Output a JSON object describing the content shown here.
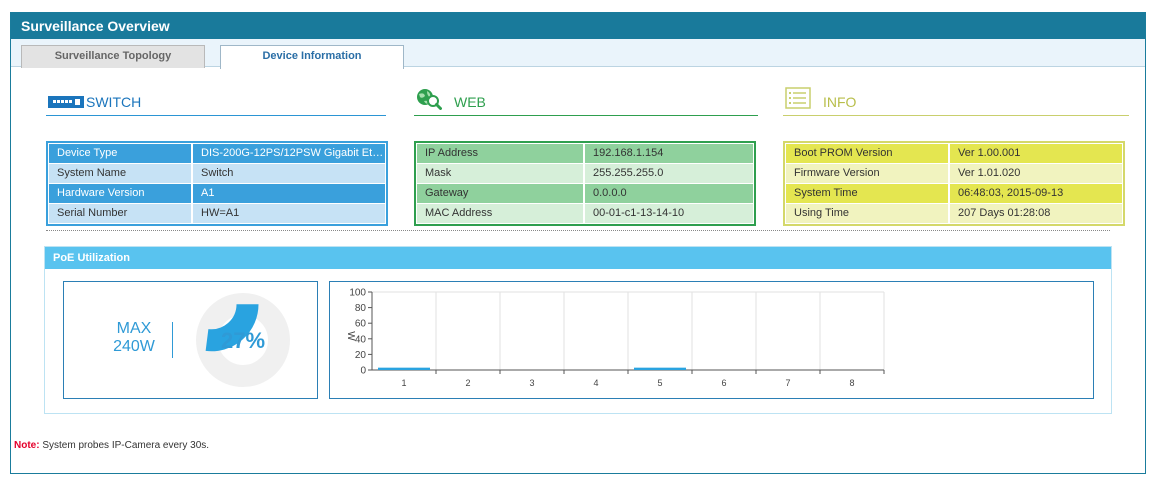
{
  "window": {
    "title": "Surveillance Overview"
  },
  "tabs": [
    {
      "label": "Surveillance Topology",
      "active": false
    },
    {
      "label": "Device Information",
      "active": true
    }
  ],
  "switch_panel": {
    "title": "SWITCH",
    "icon": "switch-icon",
    "rows": [
      {
        "key": "Device Type",
        "value": "DIS-200G-12PS/12PSW Gigabit Ethe..."
      },
      {
        "key": "System Name",
        "value": "Switch"
      },
      {
        "key": "Hardware Version",
        "value": "A1"
      },
      {
        "key": "Serial Number",
        "value": "HW=A1"
      }
    ],
    "colors": {
      "accent": "#3aa0dc",
      "light": "#c6e2f5"
    }
  },
  "web_panel": {
    "title": "WEB",
    "icon": "globe-search-icon",
    "rows": [
      {
        "key": "IP Address",
        "value": "192.168.1.154"
      },
      {
        "key": "Mask",
        "value": "255.255.255.0"
      },
      {
        "key": "Gateway",
        "value": "0.0.0.0"
      },
      {
        "key": "MAC Address",
        "value": "00-01-c1-13-14-10"
      }
    ],
    "colors": {
      "accent": "#8fd19d",
      "light": "#d6efd9"
    }
  },
  "info_panel": {
    "title": "INFO",
    "icon": "list-icon",
    "rows": [
      {
        "key": "Boot PROM Version",
        "value": "Ver 1.00.001"
      },
      {
        "key": "Firmware Version",
        "value": "Ver 1.01.020"
      },
      {
        "key": "System Time",
        "value": "06:48:03, 2015-09-13"
      },
      {
        "key": "Using Time",
        "value": "207 Days 01:28:08"
      }
    ],
    "colors": {
      "accent": "#e4e650",
      "light": "#f1f3bf"
    }
  },
  "poe": {
    "title": "PoE Utilization",
    "max_line1": "MAX",
    "max_line2": "240W",
    "utilization_percent": 27,
    "utilization_label": "27%",
    "colors": {
      "header": "#59c3ef",
      "gauge": "#29a3e0",
      "gauge_track": "#f0f0f0"
    }
  },
  "chart_data": {
    "type": "bar",
    "ylabel": "W",
    "ylim": [
      0,
      100
    ],
    "yticks": [
      "0",
      "20",
      "40",
      "60",
      "80",
      "100"
    ],
    "categories": [
      "1",
      "2",
      "3",
      "4",
      "5",
      "6",
      "7",
      "8"
    ],
    "values": [
      3,
      0,
      0,
      0,
      3,
      0,
      0,
      0
    ],
    "grid": true,
    "bar_color": "#29a3e0"
  },
  "note": {
    "label": "Note:",
    "text": " System probes IP-Camera every 30s."
  }
}
